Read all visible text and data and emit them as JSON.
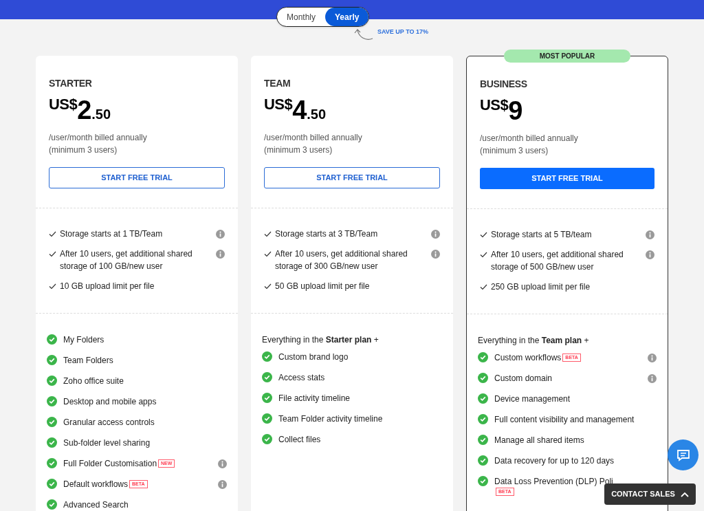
{
  "billing_toggle": [
    {
      "label": "Monthly",
      "selected": false
    },
    {
      "label": "Yearly",
      "selected": true
    }
  ],
  "save_note": "SAVE UP TO 17%",
  "plans": [
    {
      "name": "STARTER",
      "highlighted": false,
      "currency": "US$",
      "price": "2",
      "cents": ".50",
      "billing": [
        "/user/month billed annually",
        "(minimum 3 users)"
      ],
      "button": "START FREE TRIAL",
      "storage": [
        {
          "text": "Storage starts at 1 TB/Team",
          "info": true
        },
        {
          "text": "After 10 users, get additional shared storage of 100 GB/new user",
          "info": true
        },
        {
          "text": "10 GB upload limit per file",
          "info": false
        }
      ],
      "features": [
        {
          "text": "My Folders",
          "info": false
        },
        {
          "text": "Team Folders",
          "info": false
        },
        {
          "text": "Zoho office suite",
          "info": false
        },
        {
          "text": "Desktop and mobile apps",
          "info": false
        },
        {
          "text": "Granular access controls",
          "info": false
        },
        {
          "text": "Sub-folder level sharing",
          "info": false
        },
        {
          "text": "Full Folder Customisation",
          "tag": "NEW",
          "info": true
        },
        {
          "text": "Default workflows",
          "tag": "BETA",
          "info": true
        },
        {
          "text": "Advanced Search",
          "info": false
        }
      ]
    },
    {
      "name": "TEAM",
      "highlighted": false,
      "currency": "US$",
      "price": "4",
      "cents": ".50",
      "billing": [
        "/user/month billed annually",
        "(minimum 3 users)"
      ],
      "button": "START FREE TRIAL",
      "storage": [
        {
          "text": "Storage starts at 3 TB/Team",
          "info": true
        },
        {
          "text": "After 10 users, get additional shared storage of 300 GB/new user",
          "info": true
        },
        {
          "text": "50 GB upload limit per file",
          "info": false
        }
      ],
      "intro": "Everything in the **Starter plan** +",
      "features": [
        {
          "text": "Custom brand logo",
          "info": false
        },
        {
          "text": "Access stats",
          "info": false
        },
        {
          "text": "File activity timeline",
          "info": false
        },
        {
          "text": "Team Folder activity timeline",
          "info": false
        },
        {
          "text": "Collect files",
          "info": false
        }
      ]
    },
    {
      "name": "BUSINESS",
      "badge": "MOST POPULAR",
      "highlighted": true,
      "currency": "US$",
      "price": "9",
      "billing": [
        "/user/month billed annually",
        "(minimum 3 users)"
      ],
      "button": "START FREE TRIAL",
      "storage": [
        {
          "text": "Storage starts at 5 TB/team",
          "info": true
        },
        {
          "text": "After 10 users, get additional shared storage of 500 GB/new user",
          "info": true
        },
        {
          "text": "250 GB upload limit per file",
          "info": false
        }
      ],
      "intro": "Everything in the **Team plan** +",
      "features": [
        {
          "text": "Custom workflows",
          "tag": "BETA",
          "info": true
        },
        {
          "text": "Custom domain",
          "info": true
        },
        {
          "text": "Device management",
          "info": false
        },
        {
          "text": "Full content visibility and management",
          "info": false
        },
        {
          "text": "Manage all shared items",
          "info": false
        },
        {
          "text": "Data recovery for up to 120 days",
          "info": false
        },
        {
          "text": "Data Loss Prevention (DLP) Poli",
          "tag": "BETA",
          "tag_below": true,
          "info": false
        }
      ]
    }
  ],
  "contact_sales": "CONTACT SALES"
}
